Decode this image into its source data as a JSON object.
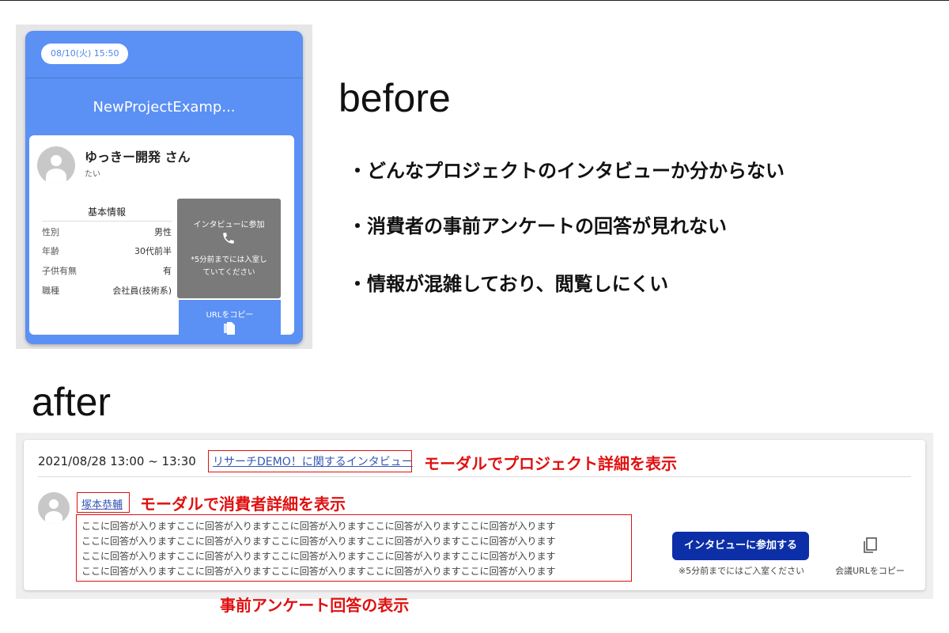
{
  "before": {
    "heading": "before",
    "date_pill": "08/10(火) 15:50",
    "project_title": "NewProjectExamp...",
    "user_name": "ゆっきー開発 さん",
    "user_sub": "たい",
    "info_heading": "基本情報",
    "info_rows": [
      {
        "key": "性別",
        "value": "男性"
      },
      {
        "key": "年齢",
        "value": "30代前半"
      },
      {
        "key": "子供有無",
        "value": "有"
      },
      {
        "key": "職種",
        "value": "会社員(技術系)"
      }
    ],
    "join_label": "インタビューに参加",
    "join_note_1": "*5分前までには入室し",
    "join_note_2": "ていてください",
    "copy_label": "URLをコピー",
    "bullets": [
      "・どんなプロジェクトのインタビューか分からない",
      "・消費者の事前アンケートの回答が見れない",
      "・情報が混雑しており、閲覧しにくい"
    ]
  },
  "after": {
    "heading": "after",
    "datetime": "2021/08/28 13:00 ~ 13:30",
    "project_link": "リサーチDEMO！に関するインタビュー",
    "project_note": "モーダルでプロジェクト詳細を表示",
    "consumer_name": "塚本恭輔",
    "consumer_note": "モーダルで消費者詳細を表示",
    "answer_lines": [
      "ここに回答が入りますここに回答が入りますここに回答が入りますここに回答が入りますここに回答が入ります",
      "ここに回答が入りますここに回答が入りますここに回答が入りますここに回答が入りますここに回答が入ります",
      "ここに回答が入りますここに回答が入りますここに回答が入りますここに回答が入りますここに回答が入ります",
      "ここに回答が入りますここに回答が入りますここに回答が入りますここに回答が入りますここに回答が入ります"
    ],
    "answer_note": "事前アンケート回答の表示",
    "join_button": "インタビューに参加する",
    "join_sub": "※5分前までにはご入室ください",
    "copy_sub": "会議URLをコピー"
  },
  "colors": {
    "before_blue": "#5b90f4",
    "join_gray": "#7a7a7a",
    "annotation_red": "#e01010",
    "link_blue": "#3457b6",
    "button_navy": "#0c2fa8"
  },
  "icons": [
    "person-icon",
    "phone-icon",
    "document-icon",
    "copy-icon"
  ]
}
